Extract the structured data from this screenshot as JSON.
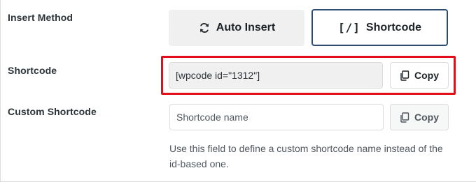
{
  "insert_method": {
    "label": "Insert Method",
    "auto_insert_label": "Auto Insert",
    "shortcode_prefix": "[/]",
    "shortcode_label": "Shortcode",
    "selected": "Shortcode"
  },
  "shortcode": {
    "label": "Shortcode",
    "value": "[wpcode id=\"1312\"]",
    "copy_label": "Copy"
  },
  "custom_shortcode": {
    "label": "Custom Shortcode",
    "placeholder": "Shortcode name",
    "copy_label": "Copy",
    "help_text": "Use this field to define a custom shortcode name instead of the id-based one."
  },
  "colors": {
    "selected_border": "#2c4b73",
    "highlight_border": "#e10f1a"
  }
}
